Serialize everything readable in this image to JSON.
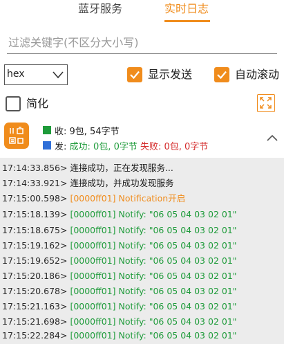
{
  "tabs": [
    {
      "label": "蓝牙服务",
      "active": false
    },
    {
      "label": "实时日志",
      "active": true
    }
  ],
  "filter": {
    "placeholder": "过滤关键字(不区分大小写)",
    "value": ""
  },
  "format_select": {
    "value": "hex"
  },
  "options": {
    "show_sent": {
      "label": "显示发送",
      "checked": true
    },
    "auto_scroll": {
      "label": "自动滚动",
      "checked": true
    },
    "simplify": {
      "label": "简化",
      "checked": false
    }
  },
  "stats": {
    "received_prefix": "收: ",
    "received": "9包, 54字节",
    "sent_prefix": "发: ",
    "sent_success": "成功: 0包, 0字节",
    "sent_fail": "失败: 0包, 0字节"
  },
  "log": [
    {
      "time": "17:14:33.856>",
      "message": "连接成功，正在发现服务...",
      "color": "black"
    },
    {
      "time": "17:14:33.921>",
      "message": "连接成功，并成功发现服务",
      "color": "black"
    },
    {
      "time": "17:15:00.598>",
      "message": "[0000ff01] Notification开启",
      "color": "orange"
    },
    {
      "time": "17:15:18.139>",
      "message": "[0000ff01] Notify: \"06 05 04 03 02 01\"",
      "color": "green"
    },
    {
      "time": "17:15:18.675>",
      "message": "[0000ff01] Notify: \"06 05 04 03 02 01\"",
      "color": "green"
    },
    {
      "time": "17:15:19.162>",
      "message": "[0000ff01] Notify: \"06 05 04 03 02 01\"",
      "color": "green"
    },
    {
      "time": "17:15:19.652>",
      "message": "[0000ff01] Notify: \"06 05 04 03 02 01\"",
      "color": "green"
    },
    {
      "time": "17:15:20.186>",
      "message": "[0000ff01] Notify: \"06 05 04 03 02 01\"",
      "color": "green"
    },
    {
      "time": "17:15:20.678>",
      "message": "[0000ff01] Notify: \"06 05 04 03 02 01\"",
      "color": "green"
    },
    {
      "time": "17:15:21.163>",
      "message": "[0000ff01] Notify: \"06 05 04 03 02 01\"",
      "color": "green"
    },
    {
      "time": "17:15:21.698>",
      "message": "[0000ff01] Notify: \"06 05 04 03 02 01\"",
      "color": "green"
    },
    {
      "time": "17:15:22.284>",
      "message": "[0000ff01] Notify: \"06 05 04 03 02 01\"",
      "color": "green"
    }
  ],
  "colors": {
    "accent": "#f08c1c",
    "success": "#1e9b3a",
    "fail": "#d42a2a",
    "received_square": "#1e9b3a",
    "sent_square": "#2f6fd8"
  }
}
